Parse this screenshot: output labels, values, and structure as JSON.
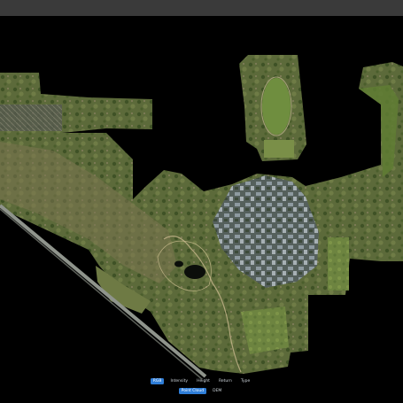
{
  "viewer": {
    "colors": {
      "background": "#000000",
      "top_bar": "#3a3a3a",
      "active_button": "#2f7ed8",
      "button_text": "#cfd6dc"
    },
    "color_modes": [
      {
        "label": "RGB",
        "active": true
      },
      {
        "label": "Intensity",
        "active": false
      },
      {
        "label": "Height",
        "active": false
      },
      {
        "label": "Return",
        "active": false
      },
      {
        "label": "Type",
        "active": false
      }
    ],
    "view_modes": [
      {
        "label": "Point Cloud",
        "active": true
      },
      {
        "label": "DEM",
        "active": false
      }
    ]
  }
}
